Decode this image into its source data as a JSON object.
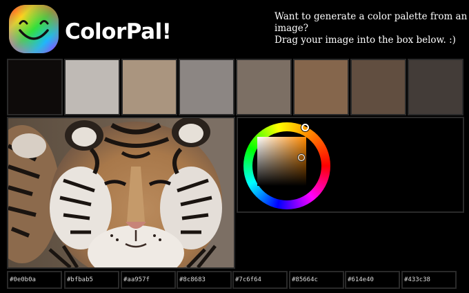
{
  "app": {
    "title": "ColorPal!"
  },
  "intro": {
    "line1": "Want to generate a color palette from an",
    "line2": "image?",
    "line3": "Drag your image into the box below. :)"
  },
  "palette": [
    {
      "color": "#0e0b0a",
      "hex": "#0e0b0a"
    },
    {
      "color": "#bfbab5",
      "hex": "#bfbab5"
    },
    {
      "color": "#aa957f",
      "hex": "#aa957f"
    },
    {
      "color": "#8c8683",
      "hex": "#8c8683"
    },
    {
      "color": "#7c6f64",
      "hex": "#7c6f64"
    },
    {
      "color": "#85664c",
      "hex": "#85664c"
    },
    {
      "color": "#614e40",
      "hex": "#614e40"
    },
    {
      "color": "#433c38",
      "hex": "#433c38"
    }
  ],
  "picker": {
    "hue_icon": "hue-ring-handle",
    "selected_hue": "#ff8a00"
  },
  "image": {
    "subject": "tiger-photo"
  }
}
